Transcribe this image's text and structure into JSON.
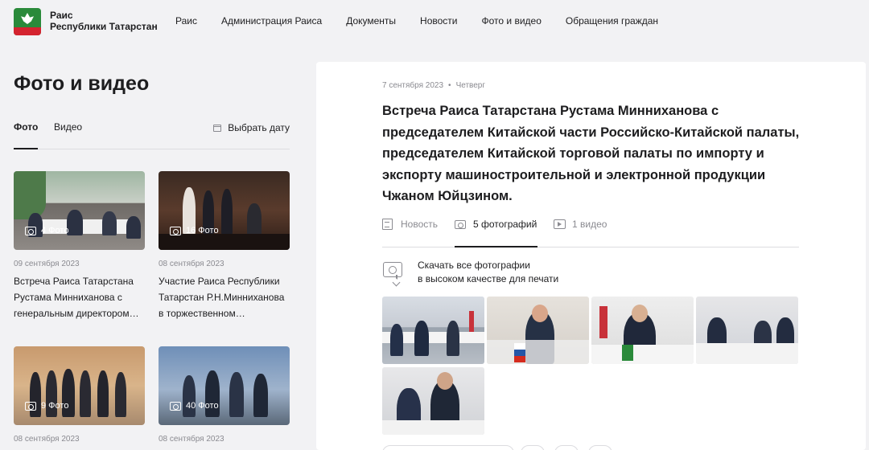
{
  "header": {
    "brand_line1": "Раис",
    "brand_line2": "Республики Татарстан",
    "nav": [
      "Раис",
      "Администрация Раиса",
      "Документы",
      "Новости",
      "Фото и видео",
      "Обращения граждан"
    ]
  },
  "left": {
    "title": "Фото и видео",
    "tabs": {
      "photo": "Фото",
      "video": "Видео"
    },
    "date_picker": "Выбрать дату",
    "cards": [
      {
        "count": "4 Фото",
        "date": "09 сентября 2023",
        "text": "Встреча Раиса Татарстана Рустама Минниханова с генеральным директором…"
      },
      {
        "count": "16 Фото",
        "date": "08 сентября 2023",
        "text": "Участие Раиса Республики Татарстан Р.Н.Минниханова в торжественном…"
      },
      {
        "count": "9 Фото",
        "date": "08 сентября 2023",
        "text": ""
      },
      {
        "count": "40 Фото",
        "date": "08 сентября 2023",
        "text": ""
      }
    ]
  },
  "article": {
    "date": "7 сентября 2023",
    "weekday": "Четверг",
    "headline": "Встреча Раиса Татарстана Рустама Минниханова с председателем Китайской части Российско-Китайской палаты, председателем Китайской торговой палаты по импорту и экспорту машиностроительной и электронной продукции Чжаном Юйцзином.",
    "tabs": {
      "news": "Новость",
      "photos": "5 фотографий",
      "video": "1 видео"
    },
    "download_line1": "Скачать все фотографии",
    "download_line2": "в высоком качестве для печати"
  },
  "colors": {
    "background": "#f2f2f4",
    "panel": "#ffffff",
    "text": "#1d1d1f",
    "muted": "#8a8a90",
    "logo_green": "#2a8a3a",
    "logo_red": "#d4232f"
  }
}
